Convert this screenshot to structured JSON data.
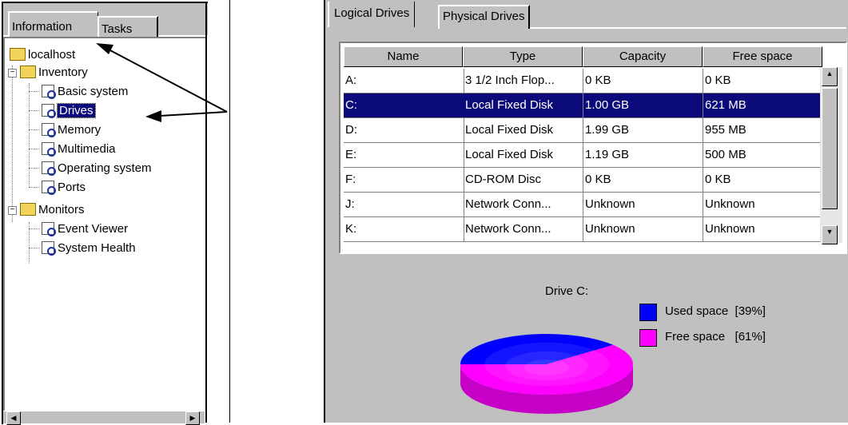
{
  "left_panel": {
    "tabs": [
      {
        "label": "Information"
      },
      {
        "label": "Tasks"
      }
    ],
    "tree": {
      "root": "localhost",
      "inventory": {
        "label": "Inventory",
        "items": [
          "Basic system",
          "Drives",
          "Memory",
          "Multimedia",
          "Operating system",
          "Ports"
        ]
      },
      "monitors": {
        "label": "Monitors",
        "items": [
          "Event Viewer",
          "System Health"
        ]
      },
      "selected": "Drives"
    }
  },
  "right_panel": {
    "tabs": [
      {
        "label": "Logical Drives"
      },
      {
        "label": "Physical Drives"
      }
    ],
    "table": {
      "columns": [
        "Name",
        "Type",
        "Capacity",
        "Free space"
      ],
      "rows": [
        {
          "name": "A:",
          "type": "3 1/2 Inch Flop...",
          "capacity": "0 KB",
          "free": "0 KB"
        },
        {
          "name": "C:",
          "type": "Local Fixed Disk",
          "capacity": "1.00 GB",
          "free": "621 MB"
        },
        {
          "name": "D:",
          "type": "Local Fixed Disk",
          "capacity": "1.99 GB",
          "free": "955 MB"
        },
        {
          "name": "E:",
          "type": "Local Fixed Disk",
          "capacity": "1.19 GB",
          "free": "500 MB"
        },
        {
          "name": "F:",
          "type": "CD-ROM Disc",
          "capacity": "0 KB",
          "free": "0 KB"
        },
        {
          "name": "J:",
          "type": "Network Conn...",
          "capacity": "Unknown",
          "free": "Unknown"
        },
        {
          "name": "K:",
          "type": "Network Conn...",
          "capacity": "Unknown",
          "free": "Unknown"
        }
      ],
      "selected_row": 1
    },
    "chart": {
      "title": "Drive C:",
      "legend": [
        {
          "label": "Used space  [39%]",
          "color": "#0000ff"
        },
        {
          "label": "Free space   [61%]",
          "color": "#ff00ff"
        }
      ]
    }
  },
  "colors": {
    "selection": "#0a0a7a",
    "panel_gray": "#c0c0c0",
    "used": "#0000ff",
    "free": "#ff00ff"
  },
  "chart_data": {
    "type": "pie",
    "title": "Drive C:",
    "slices": [
      {
        "label": "Used space",
        "value": 39,
        "color": "#0000ff"
      },
      {
        "label": "Free space",
        "value": 61,
        "color": "#ff00ff"
      }
    ]
  }
}
